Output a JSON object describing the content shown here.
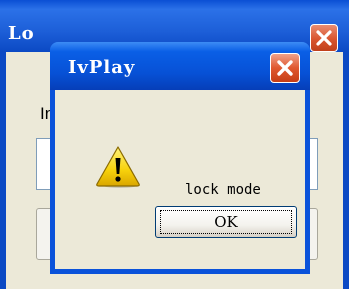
{
  "background_window": {
    "title": "Lo",
    "label": "In"
  },
  "dialog": {
    "title": "IvPlay",
    "message": "lock mode",
    "icon": "warning-icon",
    "ok_label": "OK"
  },
  "colors": {
    "titlebar_blue": "#0A52DA",
    "close_red": "#D9542E",
    "face": "#ECE9D8",
    "warning_yellow": "#F7D10B"
  }
}
